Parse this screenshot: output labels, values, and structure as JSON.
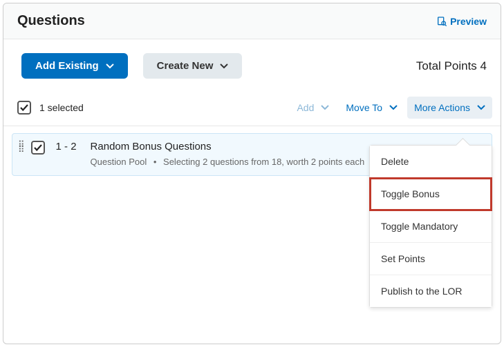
{
  "header": {
    "title": "Questions",
    "preview_label": "Preview"
  },
  "toolbar": {
    "add_existing_label": "Add Existing",
    "create_new_label": "Create New",
    "total_points_label": "Total Points",
    "total_points_value": "4"
  },
  "selection": {
    "selected_text": "1 selected",
    "add_label": "Add",
    "move_to_label": "Move To",
    "more_actions_label": "More Actions"
  },
  "row": {
    "range": "1 - 2",
    "title": "Random Bonus Questions",
    "type": "Question Pool",
    "detail": "Selecting 2 questions from 18, worth 2 points each"
  },
  "menu": {
    "delete": "Delete",
    "toggle_bonus": "Toggle Bonus",
    "toggle_mandatory": "Toggle Mandatory",
    "set_points": "Set Points",
    "publish_lor": "Publish to the LOR"
  }
}
